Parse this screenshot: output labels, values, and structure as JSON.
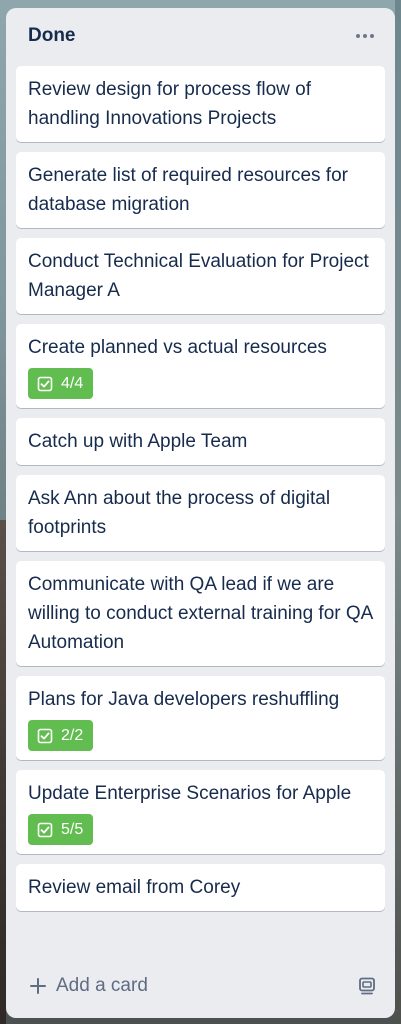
{
  "list": {
    "title": "Done",
    "more_icon": "ellipsis-icon"
  },
  "cards": [
    {
      "title": "Review design for process flow of handling Innovations Projects",
      "checklist": null
    },
    {
      "title": "Generate list of required resources for database migration",
      "checklist": null
    },
    {
      "title": "Conduct Technical Evaluation for Project Manager A",
      "checklist": null
    },
    {
      "title": "Create planned vs actual resources",
      "checklist": "4/4"
    },
    {
      "title": "Catch up with Apple Team",
      "checklist": null
    },
    {
      "title": "Ask Ann about the process of digital footprints",
      "checklist": null
    },
    {
      "title": "Communicate with QA lead if we are willing to conduct external training for QA Automation",
      "checklist": null
    },
    {
      "title": "Plans for Java developers reshuffling",
      "checklist": "2/2"
    },
    {
      "title": "Update Enterprise Scenarios for Apple",
      "checklist": "5/5"
    },
    {
      "title": "Review email from Corey",
      "checklist": null
    }
  ],
  "footer": {
    "add_card_label": "Add a card",
    "plus_icon": "plus-icon",
    "template_icon": "card-template-icon"
  },
  "colors": {
    "list_bg": "#ebecf0",
    "card_bg": "#ffffff",
    "text": "#172b4d",
    "muted": "#5e6c84",
    "badge_complete": "#61bd4f"
  }
}
